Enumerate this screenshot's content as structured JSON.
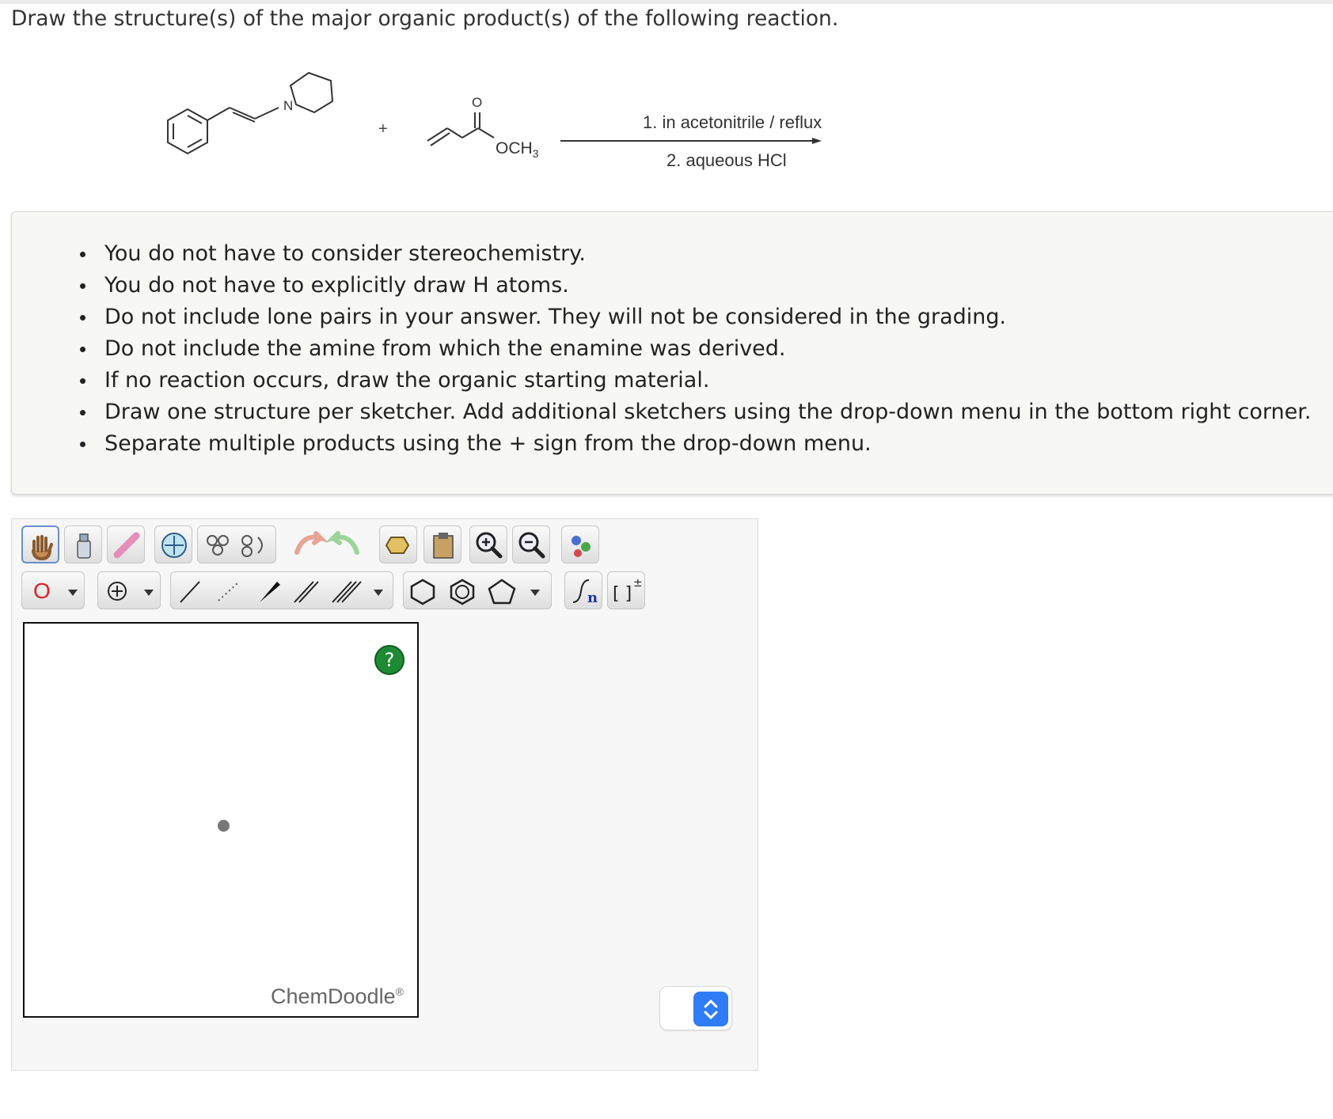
{
  "question": {
    "title": "Draw the structure(s) of the major organic product(s) of the following reaction."
  },
  "reaction": {
    "plus": "+",
    "reactant1_atom_label": "N",
    "reactant2_carbonyl_label": "O",
    "reactant2_group_label": "OCH",
    "reactant2_group_subscript": "3",
    "condition_step1": "1. in acetonitrile / reflux",
    "condition_step2": "2. aqueous HCl"
  },
  "instructions": {
    "items": [
      "You do not have to consider stereochemistry.",
      "You do not have to explicitly draw H atoms.",
      "Do not include lone pairs in your answer. They will not be considered in the grading.",
      "Do not include the amine from which the enamine was derived.",
      "If no reaction occurs, draw the organic starting material.",
      "Draw one structure per sketcher. Add additional sketchers using the drop-down menu in the bottom right corner.",
      "Separate multiple products using the + sign from the drop-down menu."
    ]
  },
  "sketcher": {
    "atom_tool_label": "O",
    "help_label": "?",
    "brand": "ChemDoodle",
    "brand_mark": "®",
    "sgroup_label": "n",
    "bracket_label": "[ ]",
    "bracket_charge": "±"
  },
  "colors": {
    "help_button": "#1f8a35",
    "stepper_button": "#2f7cf6",
    "atom_tool": "#dd2222"
  }
}
